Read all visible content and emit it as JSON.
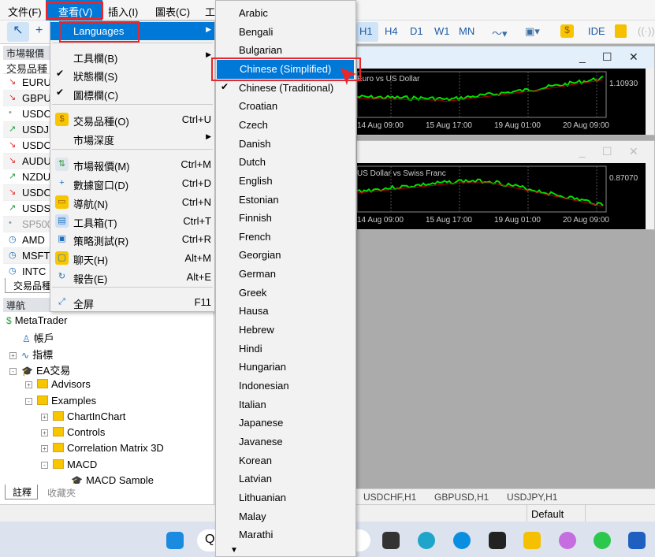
{
  "menubar": {
    "items": [
      "文件(F)",
      "查看(V)",
      "插入(I)",
      "圖表(C)",
      "工"
    ]
  },
  "toolbar": {
    "timeframes": [
      "H1",
      "H4",
      "D1",
      "W1",
      "MN"
    ],
    "ide": "IDE"
  },
  "market_watch": {
    "title": "市場報價",
    "column": "交易品種",
    "symbols": [
      {
        "name": "EURUS",
        "dir": "down"
      },
      {
        "name": "GBPUS",
        "dir": "down"
      },
      {
        "name": "USDCI",
        "dir": "none"
      },
      {
        "name": "USDJP",
        "dir": "up"
      },
      {
        "name": "USDCI",
        "dir": "down"
      },
      {
        "name": "AUDU",
        "dir": "down"
      },
      {
        "name": "NZDU",
        "dir": "up"
      },
      {
        "name": "USDC/",
        "dir": "down"
      },
      {
        "name": "USDSE",
        "dir": "up"
      },
      {
        "name": "SP500",
        "dir": "none"
      },
      {
        "name": "AMD",
        "dir": "clock"
      },
      {
        "name": "MSFT",
        "dir": "clock"
      },
      {
        "name": "INTC",
        "dir": "clock"
      }
    ],
    "tab": "交易品種"
  },
  "navigator": {
    "title": "導航",
    "tree": [
      "MetaTrader",
      "帳戶",
      "指標",
      "EA交易",
      "Advisors",
      "Examples",
      "ChartInChart",
      "Controls",
      "Correlation Matrix 3D",
      "MACD",
      "MACD Sample"
    ],
    "tabs": [
      "註釋",
      "收藏夾"
    ]
  },
  "charts": [
    {
      "title": "Euro vs US Dollar",
      "price": "1.10930",
      "times": [
        "14 Aug 09:00",
        "15 Aug 17:00",
        "19 Aug 01:00",
        "20 Aug 09:00"
      ]
    },
    {
      "title": "US Dollar vs Swiss Franc",
      "price": "0.87070",
      "times": [
        "14 Aug 09:00",
        "15 Aug 17:00",
        "19 Aug 01:00",
        "20 Aug 09:00"
      ]
    }
  ],
  "chart_tabs": [
    "USDCHF,H1",
    "GBPUSD,H1",
    "USDJPY,H1"
  ],
  "status": {
    "profile": "Default"
  },
  "view_menu": {
    "items": [
      {
        "label": "Languages",
        "submenu": true,
        "highlighted": true
      },
      {
        "label": "工具欄(B)",
        "submenu": true
      },
      {
        "label": "狀態欄(S)",
        "checked": true
      },
      {
        "label": "圖標欄(C)",
        "checked": true
      },
      {
        "label": "交易品種(O)",
        "shortcut": "Ctrl+U",
        "icon": "dollar-icon"
      },
      {
        "label": "市場深度",
        "submenu": true
      },
      {
        "label": "市場報價(M)",
        "shortcut": "Ctrl+M",
        "icon": "market-watch-icon"
      },
      {
        "label": "數據窗口(D)",
        "shortcut": "Ctrl+D",
        "icon": "data-window-icon"
      },
      {
        "label": "導航(N)",
        "shortcut": "Ctrl+N",
        "icon": "navigator-icon"
      },
      {
        "label": "工具箱(T)",
        "shortcut": "Ctrl+T",
        "icon": "toolbox-icon"
      },
      {
        "label": "策略測試(R)",
        "shortcut": "Ctrl+R",
        "icon": "strategy-tester-icon"
      },
      {
        "label": "聊天(H)",
        "shortcut": "Alt+M",
        "icon": "chat-icon"
      },
      {
        "label": "報告(E)",
        "shortcut": "Alt+E",
        "icon": "report-icon"
      },
      {
        "label": "全屏",
        "shortcut": "F11",
        "icon": "fullscreen-icon"
      }
    ]
  },
  "languages": {
    "items": [
      "Arabic",
      "Bengali",
      "Bulgarian",
      "Chinese (Simplified)",
      "Chinese (Traditional)",
      "Croatian",
      "Czech",
      "Danish",
      "Dutch",
      "English",
      "Estonian",
      "Finnish",
      "French",
      "Georgian",
      "German",
      "Greek",
      "Hausa",
      "Hebrew",
      "Hindi",
      "Hungarian",
      "Indonesian",
      "Italian",
      "Japanese",
      "Javanese",
      "Korean",
      "Latvian",
      "Lithuanian",
      "Malay",
      "Marathi"
    ],
    "highlighted": "Chinese (Simplified)",
    "checked": "Chinese (Traditional)"
  },
  "colors": {
    "accent": "#0078d7",
    "annotation": "#e8272a",
    "candle": "#00e000",
    "ma": "#c00000"
  }
}
